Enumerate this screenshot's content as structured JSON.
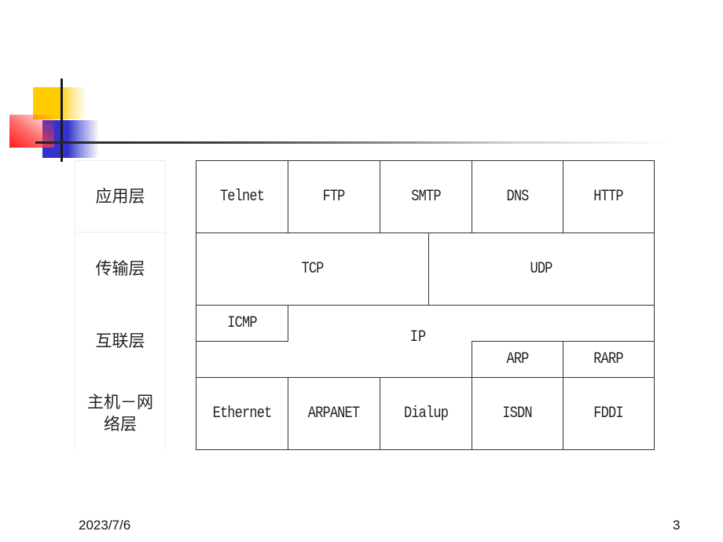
{
  "layers": [
    {
      "label": "应用层"
    },
    {
      "label": "传输层"
    },
    {
      "label": "互联层"
    },
    {
      "label": "主机－网\n络层",
      "line1": "主机－网",
      "line2": "络层"
    }
  ],
  "protocols": {
    "application": [
      "Telnet",
      "FTP",
      "SMTP",
      "DNS",
      "HTTP"
    ],
    "transport": [
      "TCP",
      "UDP"
    ],
    "internet": {
      "icmp": "ICMP",
      "ip": "IP",
      "arp": "ARP",
      "rarp": "RARP"
    },
    "network": [
      "Ethernet",
      "ARPANET",
      "Dialup",
      "ISDN",
      "FDDI"
    ]
  },
  "footer": {
    "date": "2023/7/6",
    "page_number": "3"
  },
  "colors": {
    "yellow": "#ffcc00",
    "blue": "#3333cc",
    "red": "#ff1a1a",
    "line": "#222222"
  }
}
